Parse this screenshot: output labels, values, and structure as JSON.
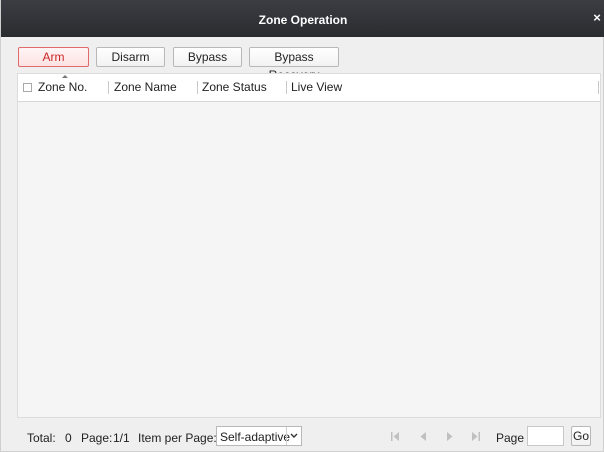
{
  "dialog": {
    "title": "Zone Operation",
    "close_glyph": "×"
  },
  "toolbar": {
    "arm_label": "Arm",
    "disarm_label": "Disarm",
    "bypass_label": "Bypass",
    "bypass_recovery_label": "Bypass Recovery"
  },
  "table": {
    "columns": [
      "Zone No.",
      "Zone Name",
      "Zone Status",
      "Live View"
    ],
    "rows": []
  },
  "footer": {
    "total_label": "Total:",
    "total_value": "0",
    "page_label": "Page:",
    "page_value": "1/1",
    "items_label": "Item per Page:",
    "items_selected": "Self-adaptive",
    "goto_label": "Page",
    "goto_value": "",
    "go_label": "Go"
  },
  "icons": [
    "close-icon",
    "checkbox-icon",
    "sort-asc-icon",
    "chevron-down-icon",
    "first-page-icon",
    "prev-page-icon",
    "next-page-icon",
    "last-page-icon"
  ],
  "colors": {
    "title_bar": "#2f3236",
    "active_button_border": "#e06a6a",
    "active_button_text": "#c92727",
    "panel_bg": "#efefef"
  }
}
